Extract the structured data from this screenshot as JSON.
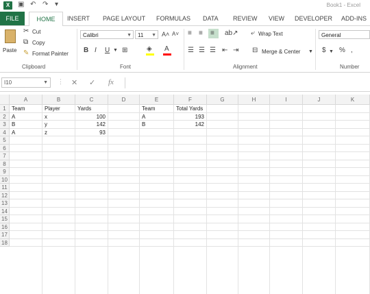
{
  "window": {
    "title": "Book1 - Excel"
  },
  "tabs": [
    "FILE",
    "HOME",
    "INSERT",
    "PAGE LAYOUT",
    "FORMULAS",
    "DATA",
    "REVIEW",
    "VIEW",
    "DEVELOPER",
    "ADD-INS"
  ],
  "clipboard": {
    "paste": "Paste",
    "cut": "Cut",
    "copy": "Copy",
    "format_painter": "Format Painter",
    "label": "Clipboard"
  },
  "font": {
    "name": "Calibri",
    "size": "11",
    "bold": "B",
    "italic": "I",
    "underline": "U",
    "label": "Font"
  },
  "alignment": {
    "wrap": "Wrap Text",
    "merge": "Merge & Center",
    "label": "Alignment"
  },
  "number": {
    "format": "General",
    "currency": "$",
    "percent": "%",
    "label": "Number"
  },
  "formula_bar": {
    "name_box": "I10",
    "fx": "fx",
    "value": ""
  },
  "columns": [
    "A",
    "B",
    "C",
    "D",
    "E",
    "F",
    "G",
    "H",
    "I",
    "J",
    "K"
  ],
  "rows": [
    "1",
    "2",
    "3",
    "4",
    "5",
    "6",
    "7",
    "8",
    "9",
    "10",
    "11",
    "12",
    "13",
    "14",
    "15",
    "16",
    "17",
    "18"
  ],
  "cells": {
    "A1": "Team",
    "B1": "Player",
    "C1": "Yards",
    "A2": "A",
    "B2": "x",
    "C2": "100",
    "A3": "B",
    "B3": "y",
    "C3": "142",
    "A4": "A",
    "B4": "z",
    "C4": "93",
    "E1": "Team",
    "F1": "Total Yards",
    "E2": "A",
    "F2": "193",
    "E3": "B",
    "F3": "142"
  },
  "colors": {
    "accent": "#217346",
    "grid": "#e2e2e2",
    "header_bg": "#f3f3f3"
  }
}
